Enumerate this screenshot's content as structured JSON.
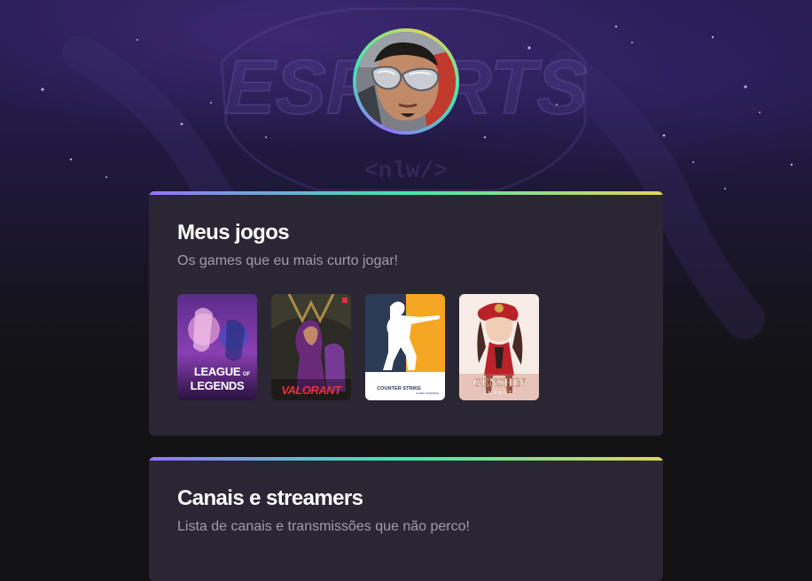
{
  "profile": {
    "avatar_alt": "Avatar"
  },
  "background": {
    "logo_text": "ESPORTS",
    "tag_text": "<nlw/>"
  },
  "games_section": {
    "title": "Meus jogos",
    "subtitle": "Os games que eu mais curto jogar!",
    "games": [
      {
        "name": "League of Legends",
        "art_line1": "LEAGUE",
        "art_of": "OF",
        "art_line2": "LEGENDS"
      },
      {
        "name": "Valorant",
        "art_text": "VALORANT"
      },
      {
        "name": "Counter Strike",
        "art_text": "COUNTER STRIKE",
        "art_sub": "GLOBAL OFFENSIVE"
      },
      {
        "name": "Genshin Impact",
        "art_text": "GENSHIN",
        "art_sub": "IMPACT"
      }
    ]
  },
  "channels_section": {
    "title": "Canais e streamers",
    "subtitle": "Lista de canais e transmissões que não perco!"
  },
  "colors": {
    "accent_purple": "#9572fc",
    "accent_green": "#43e7ad",
    "accent_yellow": "#e2d45c",
    "card_bg": "#2a2634",
    "page_bg": "#121214"
  }
}
